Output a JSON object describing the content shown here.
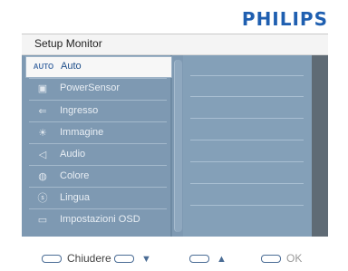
{
  "brand": "PHILIPS",
  "menu_title": "Setup Monitor",
  "items": [
    {
      "icon": "AUTO",
      "label": "Auto",
      "selected": true
    },
    {
      "icon": "▣",
      "label": "PowerSensor"
    },
    {
      "icon": "⇐",
      "label": "Ingresso"
    },
    {
      "icon": "☀",
      "label": "Immagine"
    },
    {
      "icon": "◁",
      "label": "Audio"
    },
    {
      "icon": "◍",
      "label": "Colore"
    },
    {
      "icon": "ⓢ",
      "label": "Lingua"
    },
    {
      "icon": "▭",
      "label": "Impostazioni OSD"
    }
  ],
  "footer": {
    "close": "Chiudere",
    "down": "▼",
    "up": "▲",
    "ok": "OK"
  },
  "colors": {
    "brand": "#1f5fb0",
    "panel": "#7e99b2",
    "selected_text": "#1f4f8a"
  }
}
